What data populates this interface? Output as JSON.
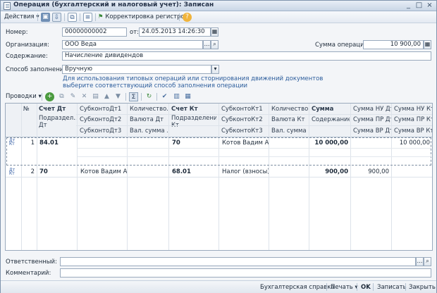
{
  "window": {
    "title": "Операция (бухгалтерский и налоговый учет): Записан",
    "buttons": {
      "minimize": "_",
      "maximize": "□",
      "close": "×"
    }
  },
  "toolbar": {
    "actions_label": "Действия",
    "registers_label": "Корректировка регистров",
    "help_label": "?"
  },
  "form": {
    "number_label": "Номер:",
    "number_value": "00000000002",
    "from_label": "от:",
    "date_value": "24.05.2013 14:26:30",
    "org_label": "Организация:",
    "org_value": "ООО Веда",
    "sum_label": "Сумма операции:",
    "sum_value": "10 900,00",
    "content_label": "Содержание:",
    "content_value": "Начисление дивидендов",
    "fill_method_label": "Способ заполнения:",
    "fill_method_value": "Вручную",
    "hint_line1": "Для использования типовых операций или сторнирования движений документов",
    "hint_line2": "выберите соответствующий способ заполнения операции"
  },
  "grid_toolbar": {
    "postings_label": "Проводки"
  },
  "table": {
    "headers": {
      "row1": [
        "№",
        "Счет Дт",
        "СубконтоДт1",
        "Количество...",
        "Счет Кт",
        "СубконтоКт1",
        "Количество...",
        "Сумма",
        "Сумма НУ Дт",
        "Сумма НУ Кт"
      ],
      "row2": [
        "",
        "Подраздел... Дт",
        "СубконтоДт2",
        "Валюта Дт",
        "Подразделение Кт",
        "СубконтоКт2",
        "Валюта Кт",
        "Содержание",
        "Сумма ПР Дт",
        "Сумма ПР Кт"
      ],
      "row3": [
        "",
        "",
        "СубконтоДт3",
        "Вал. сумма ...",
        "",
        "СубконтоКт3",
        "Вал. сумма ...",
        "",
        "Сумма ВР Дт",
        "Сумма ВР Кт"
      ]
    },
    "rows": [
      {
        "n": "1",
        "dt": "84.01",
        "sub_dt1": "",
        "kt": "70",
        "sub_kt1": "Котов Вадим А...",
        "sum": "10 000,00",
        "nu_dt": "",
        "nu_kt": "10 000,00"
      },
      {
        "n": "2",
        "dt": "70",
        "sub_dt1": "Котов Вадим А...",
        "kt": "68.01",
        "sub_kt1": "Налог (взносы)...",
        "sum": "900,00",
        "nu_dt": "900,00",
        "nu_kt": ""
      }
    ],
    "row_icon": "Дт Кт"
  },
  "footer": {
    "responsible_label": "Ответственный:",
    "responsible_value": "",
    "comment_label": "Комментарий:",
    "comment_value": ""
  },
  "bottom_bar": {
    "accounting_ref": "Бухгалтерская справка",
    "print_label": "Печать",
    "ok_label": "OK",
    "save_label": "Записать",
    "close_label": "Закрыть"
  },
  "colors": {
    "accent": "#2c5d9c",
    "selected_row_border": "#7f8fa3"
  }
}
